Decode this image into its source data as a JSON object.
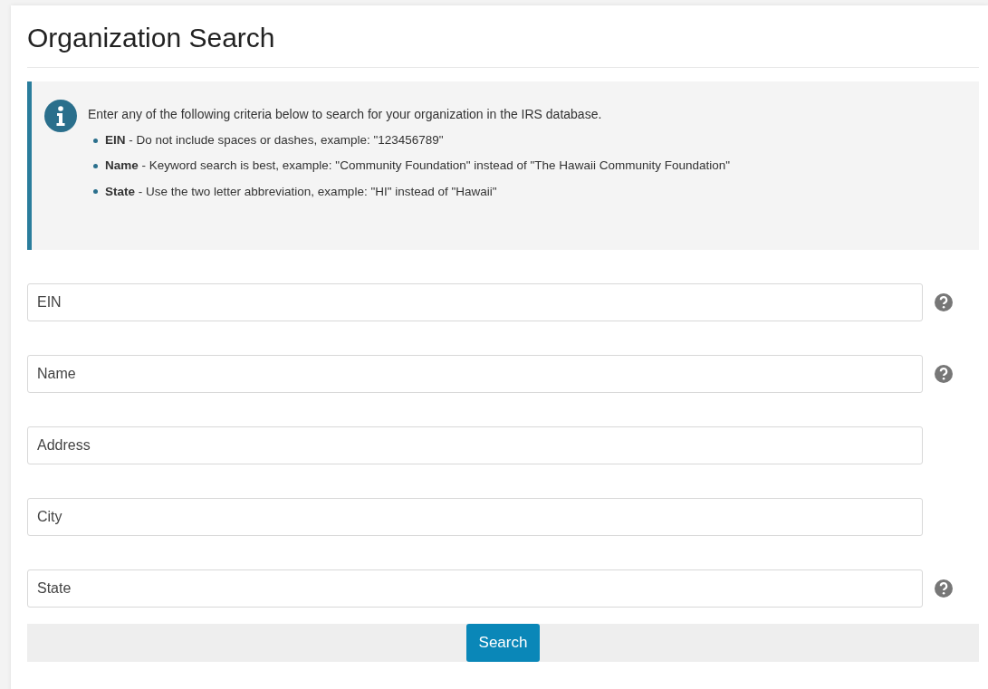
{
  "title": "Organization Search",
  "info": {
    "intro": "Enter any of the following criteria below to search for your organization in the IRS database.",
    "bullets": [
      "**EIN** - Do not include spaces or dashes, example: \"123456789\"",
      "**Name** - Keyword search is best, example: \"Community Foundation\" instead of \"The Hawaii Community Foundation\"",
      "**State** - Use the two letter abbreviation, example: \"HI\" instead of \"Hawaii\""
    ]
  },
  "fields": [
    {
      "placeholder": "EIN",
      "help": true
    },
    {
      "placeholder": "Name",
      "help": true
    },
    {
      "placeholder": "Address",
      "help": false
    },
    {
      "placeholder": "City",
      "help": false
    },
    {
      "placeholder": "State",
      "help": true
    }
  ],
  "button": "Search"
}
